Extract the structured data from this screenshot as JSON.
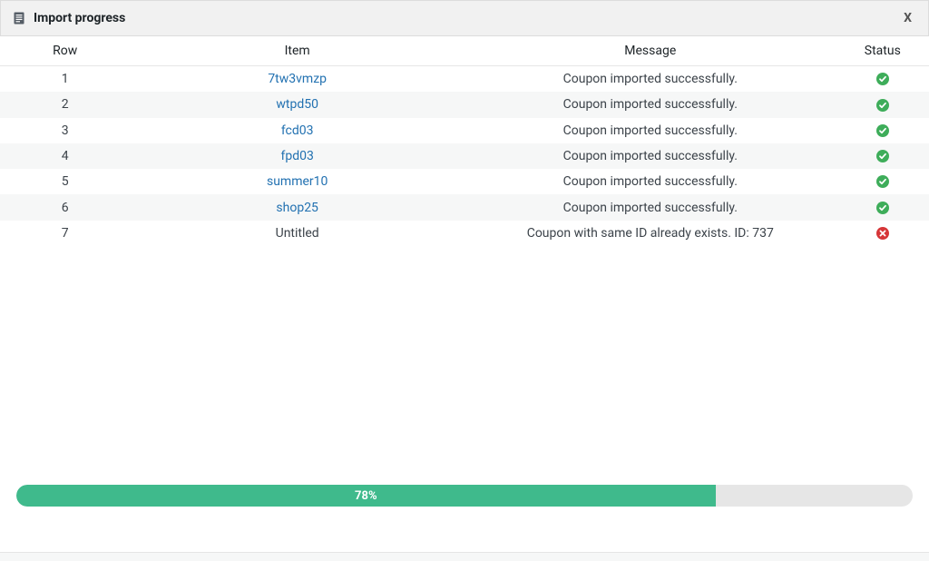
{
  "header": {
    "title": "Import progress",
    "close_label": "X"
  },
  "columns": {
    "row": "Row",
    "item": "Item",
    "message": "Message",
    "status": "Status"
  },
  "rows": [
    {
      "row": "1",
      "item": "7tw3vmzp",
      "item_is_link": true,
      "message": "Coupon imported successfully.",
      "status": "success"
    },
    {
      "row": "2",
      "item": "wtpd50",
      "item_is_link": true,
      "message": "Coupon imported successfully.",
      "status": "success"
    },
    {
      "row": "3",
      "item": "fcd03",
      "item_is_link": true,
      "message": "Coupon imported successfully.",
      "status": "success"
    },
    {
      "row": "4",
      "item": "fpd03",
      "item_is_link": true,
      "message": "Coupon imported successfully.",
      "status": "success"
    },
    {
      "row": "5",
      "item": "summer10",
      "item_is_link": true,
      "message": "Coupon imported successfully.",
      "status": "success"
    },
    {
      "row": "6",
      "item": "shop25",
      "item_is_link": true,
      "message": "Coupon imported successfully.",
      "status": "success"
    },
    {
      "row": "7",
      "item": "Untitled",
      "item_is_link": false,
      "message": "Coupon with same ID already exists. ID: 737",
      "status": "error"
    }
  ],
  "progress": {
    "percent": 78,
    "label": "78%"
  },
  "colors": {
    "link": "#2271b1",
    "success": "#3ead5a",
    "error": "#d63638",
    "progress": "#3fba8c"
  }
}
